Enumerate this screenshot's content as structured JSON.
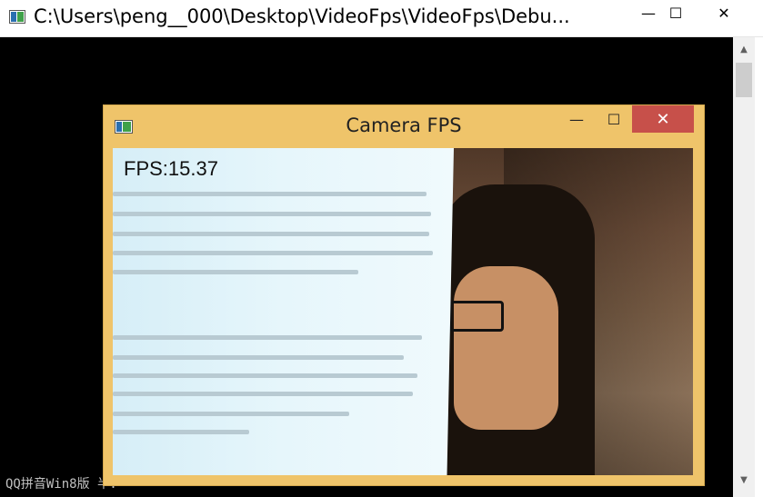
{
  "console": {
    "title": "C:\\Users\\peng__000\\Desktop\\VideoFps\\VideoFps\\Debu...",
    "icon": "console-window-icon",
    "minimize": "—",
    "maximize": "☐",
    "close": "✕",
    "status_line": "QQ拼音Win8版 半："
  },
  "camera_window": {
    "title": "Camera FPS",
    "icon": "camera-window-icon",
    "minimize": "—",
    "maximize": "☐",
    "close": "✕",
    "fps_text": "FPS:15.37",
    "close_color": "#c7504a",
    "frame_color": "#efc46a"
  },
  "scrollbar": {
    "up": "▲",
    "down": "▼"
  }
}
